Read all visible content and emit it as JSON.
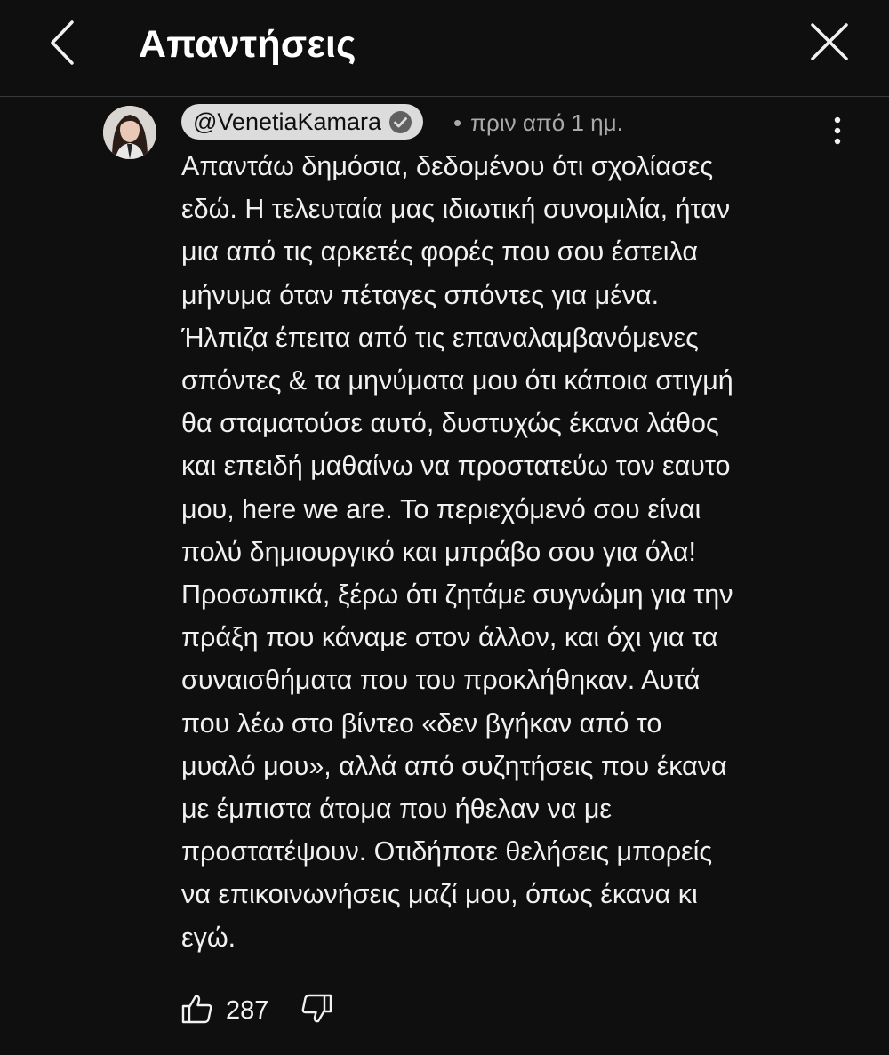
{
  "header": {
    "title": "Απαντήσεις",
    "back_icon": "chevron-left-icon",
    "close_icon": "close-icon"
  },
  "comment": {
    "author": "@VenetiaKamara",
    "verified_icon": "verified-badge-icon",
    "separator": "•",
    "time": "πριν από 1 ημ.",
    "more_icon": "more-vertical-icon",
    "text": "Απαντάω δημόσια, δεδομένου ότι σχολίασες\nεδώ. Η τελευταία μας ιδιωτική συνομιλία, ήταν\nμια από τις αρκετές φορές που σου έστειλα\nμήνυμα όταν πέταγες σπόντες για μένα.\nΉλπιζα έπειτα από τις επαναλαμβανόμενες\nσπόντες & τα μηνύματα μου ότι κάποια στιγμή\nθα σταματούσε αυτό, δυστυχώς έκανα λάθος\nκαι επειδή μαθαίνω να προστατεύω τον εαυτο\nμου, here we are. Το περιεχόμενό σου είναι\nπολύ δημιουργικό και μπράβο σου για όλα!\nΠροσωπικά, ξέρω ότι ζητάμε συγνώμη για την\nπράξη που κάναμε στον άλλον, και όχι για τα\nσυναισθήματα που του προκλήθηκαν. Αυτά\nπου λέω στο βίντεο «δεν βγήκαν από το\nμυαλό μου», αλλά από συζητήσεις που έκανα\nμε έμπιστα άτομα που ήθελαν να με\nπροστατέψουν. Οτιδήποτε θελήσεις μπορείς\nνα επικοινωνήσεις μαζί μου, όπως έκανα κι\nεγώ.",
    "likes": "287",
    "like_icon": "thumbs-up-icon",
    "dislike_icon": "thumbs-down-icon"
  },
  "colors": {
    "background": "#0f0f0f",
    "text": "#f1f1f1",
    "muted": "#aaaaaa",
    "chip": "#dcdcdc"
  }
}
